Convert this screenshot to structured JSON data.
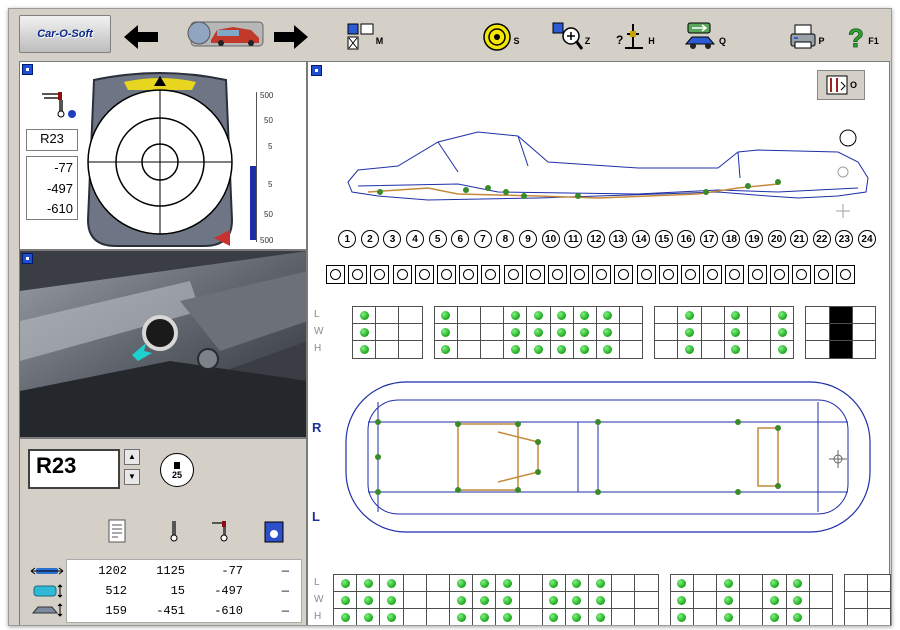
{
  "app": {
    "logo": "Car-O-Soft"
  },
  "toolbar": {
    "keys": {
      "menu": "M",
      "s": "S",
      "z": "Z",
      "h": "H",
      "q": "Q",
      "print": "P",
      "help": "F1",
      "o": "O"
    }
  },
  "readout": {
    "point": "R23",
    "values": [
      "-77",
      "-497",
      "-610"
    ],
    "scale_top": [
      "500",
      "50",
      "5"
    ],
    "scale_bottom": [
      "5",
      "50",
      "500"
    ]
  },
  "selector": {
    "point": "R23",
    "badge": "25"
  },
  "table": {
    "rows": [
      [
        "1202",
        "1125",
        "-77",
        "—"
      ],
      [
        "512",
        "15",
        "-497",
        "—"
      ],
      [
        "159",
        "-451",
        "-610",
        "—"
      ]
    ]
  },
  "diagram": {
    "numbers": [
      "1",
      "2",
      "3",
      "4",
      "5",
      "6",
      "7",
      "8",
      "9",
      "10",
      "11",
      "12",
      "13",
      "14",
      "15",
      "16",
      "17",
      "18",
      "19",
      "20",
      "21",
      "22",
      "23",
      "24"
    ],
    "side_right": "R",
    "side_left": "L",
    "axis_labels": [
      "L",
      "W",
      "H"
    ]
  }
}
